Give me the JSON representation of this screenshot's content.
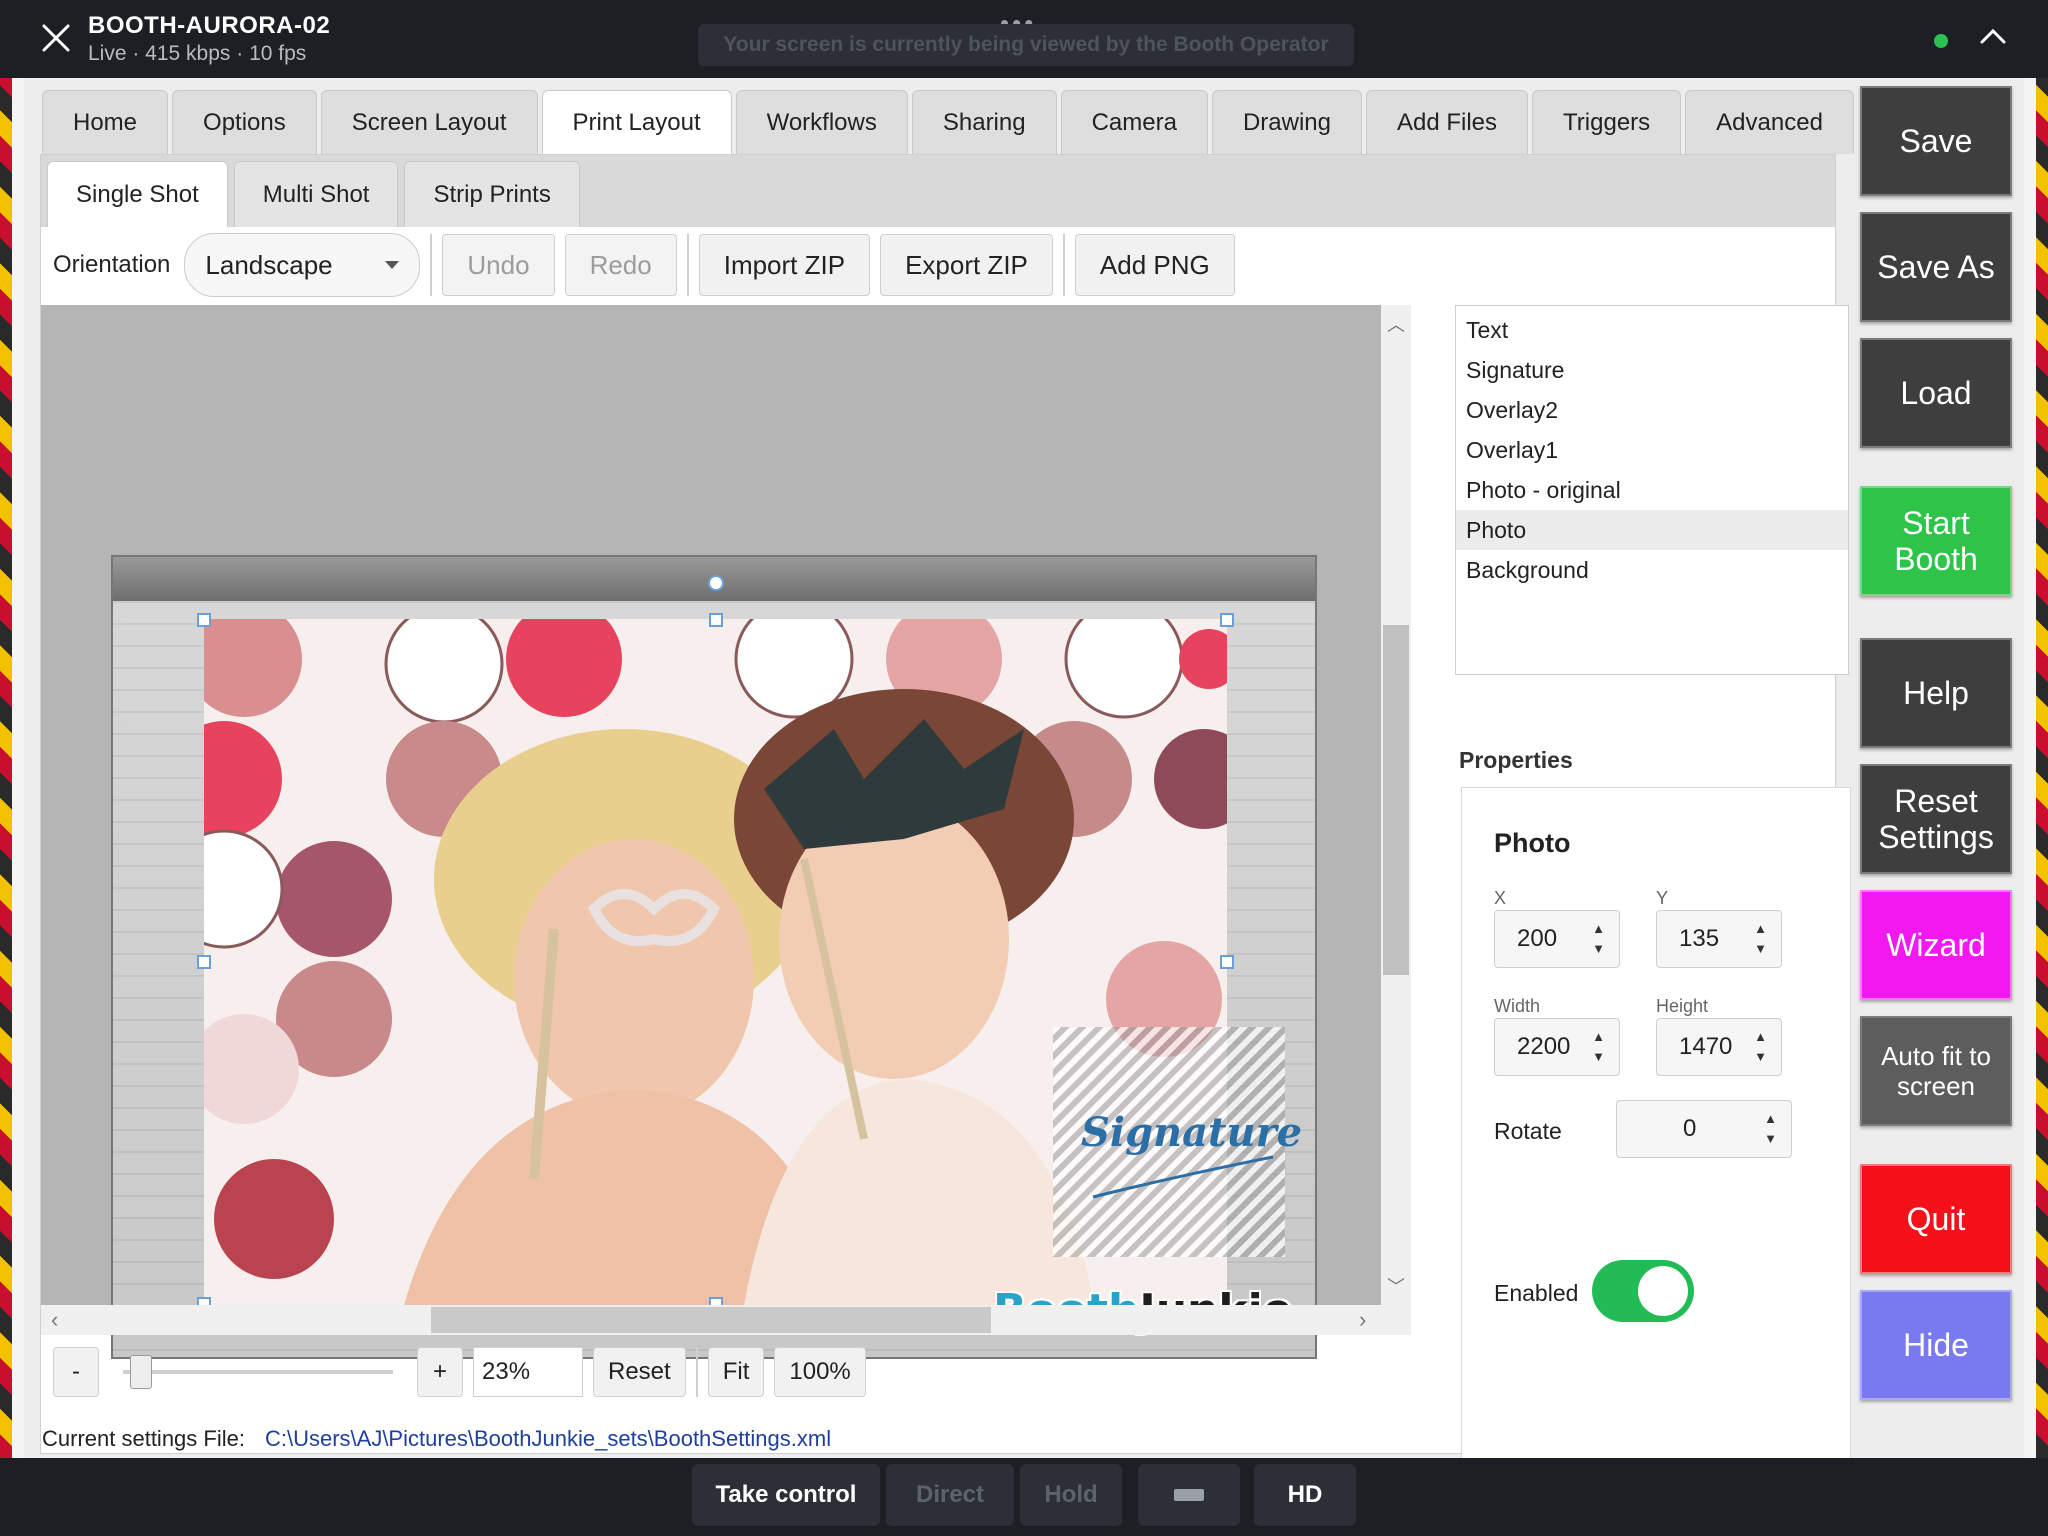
{
  "remote": {
    "session_name": "BOOTH-AURORA-02",
    "stats": "Live · 415 kbps · 10 fps",
    "viewing_banner": "Your screen is currently being viewed by the Booth Operator",
    "bottom_buttons": {
      "take_control": "Take control",
      "direct": "Direct",
      "hold": "Hold",
      "hd": "HD"
    }
  },
  "tabs": [
    "Home",
    "Options",
    "Screen Layout",
    "Print Layout",
    "Workflows",
    "Sharing",
    "Camera",
    "Drawing",
    "Add Files",
    "Triggers",
    "Advanced"
  ],
  "active_tab": "Print Layout",
  "sub_tabs": [
    "Single Shot",
    "Multi Shot",
    "Strip Prints"
  ],
  "active_sub_tab": "Single Shot",
  "toolbar": {
    "orientation_label": "Orientation",
    "orientation_value": "Landscape",
    "undo": "Undo",
    "redo": "Redo",
    "import_zip": "Import ZIP",
    "export_zip": "Export ZIP",
    "add_png": "Add PNG"
  },
  "canvas": {
    "signature_text": "Signature",
    "logo_part1": "Booth",
    "logo_part2": "Junkie"
  },
  "zoom": {
    "minus": "-",
    "plus": "+",
    "value": "23%",
    "reset": "Reset",
    "fit": "Fit",
    "full": "100%",
    "slider_fraction": 0.03
  },
  "layers": [
    "Text",
    "Signature",
    "Overlay2",
    "Overlay1",
    "Photo - original",
    "Photo",
    "Background"
  ],
  "selected_layer": "Photo",
  "properties": {
    "header": "Properties",
    "title": "Photo",
    "x_label": "X",
    "x_value": "200",
    "y_label": "Y",
    "y_value": "135",
    "width_label": "Width",
    "width_value": "2200",
    "height_label": "Height",
    "height_value": "1470",
    "rotate_label": "Rotate",
    "rotate_value": "0",
    "enabled_label": "Enabled",
    "enabled": true
  },
  "side_buttons": {
    "save": "Save",
    "save_as": "Save As",
    "load": "Load",
    "start_booth": "Start Booth",
    "help": "Help",
    "reset_settings": "Reset Settings",
    "wizard": "Wizard",
    "auto_fit": "Auto fit to screen",
    "quit": "Quit",
    "hide": "Hide"
  },
  "colors": {
    "start_booth": "#2ec44a",
    "wizard": "#f218f0",
    "quit": "#f5101a",
    "hide": "#7a7af0",
    "dark_button": "#3e3e3e",
    "toggle_on": "#22bb55"
  },
  "status": {
    "label": "Current settings File:",
    "path": "C:\\Users\\AJ\\Pictures\\BoothJunkie_sets\\BoothSettings.xml"
  }
}
